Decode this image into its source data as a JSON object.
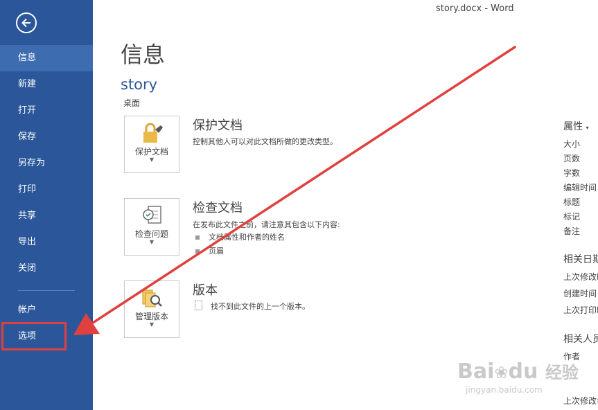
{
  "window": {
    "title": "story.docx - Word"
  },
  "sidebar": {
    "items": [
      {
        "label": "信息",
        "active": true
      },
      {
        "label": "新建"
      },
      {
        "label": "打开"
      },
      {
        "label": "保存"
      },
      {
        "label": "另存为"
      },
      {
        "label": "打印"
      },
      {
        "label": "共享"
      },
      {
        "label": "导出"
      },
      {
        "label": "关闭"
      },
      {
        "label": "帐户"
      },
      {
        "label": "选项"
      }
    ]
  },
  "main": {
    "title": "信息",
    "doc_name": "story",
    "doc_location": "桌面",
    "sections": [
      {
        "tile_label": "保护文档",
        "heading": "保护文档",
        "desc": "控制其他人可以对此文档所做的更改类型。"
      },
      {
        "tile_label": "检查问题",
        "heading": "检查文档",
        "desc": "在发布此文件之前，请注意其包含以下内容:",
        "bullets": [
          "文档属性和作者的姓名",
          "页眉"
        ]
      },
      {
        "tile_label": "管理版本",
        "heading": "版本",
        "desc": "找不到此文件的上一个版本。"
      }
    ]
  },
  "properties": {
    "heading": "属性",
    "items": [
      "大小",
      "页数",
      "字数",
      "编辑时间",
      "标题",
      "标记",
      "备注"
    ],
    "dates_heading": "相关日期",
    "dates": [
      "上次修改时间",
      "创建时间",
      "上次打印时间"
    ],
    "people_heading": "相关人员",
    "people": [
      "作者"
    ],
    "last_modified_by": "上次修改者"
  },
  "watermark": {
    "brand": "Bai",
    "brand2": "du",
    "cn": "经验",
    "url": "jingyan.baidu.com"
  },
  "colors": {
    "sidebar": "#2b579a",
    "active": "#3d6cb0",
    "annotation": "#e0403e"
  }
}
